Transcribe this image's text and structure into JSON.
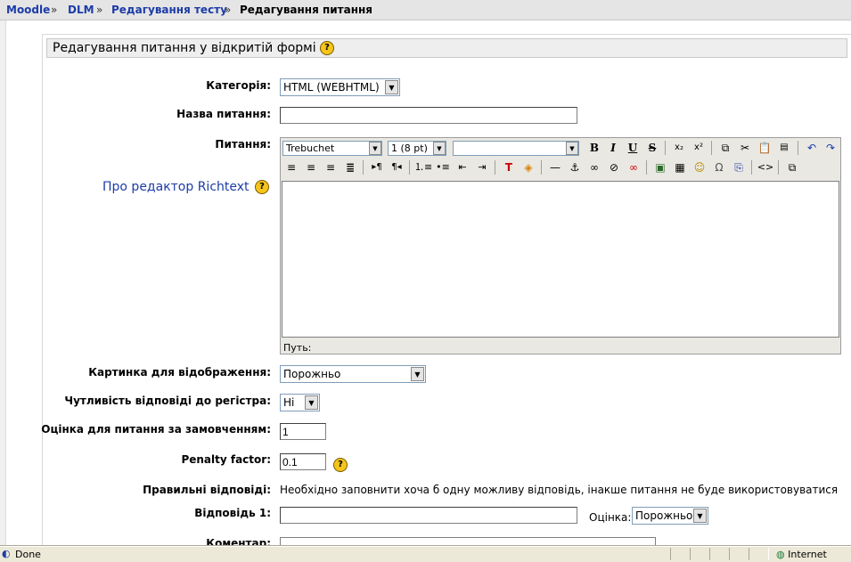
{
  "breadcrumb": {
    "items": [
      "Moodle",
      "DLM",
      "Редагування тесту",
      "Редагування питання"
    ],
    "separator": "»"
  },
  "section": {
    "title": "Редагування питання у відкритій формі"
  },
  "form": {
    "category": {
      "label": "Категорія:",
      "value": "HTML (WEBHTML)"
    },
    "question_name": {
      "label": "Назва питання:",
      "value": ""
    },
    "question_text": {
      "label": "Питання:"
    },
    "richtext_link": "Про редактор Richtext",
    "editor": {
      "font": "Trebuchet",
      "size": "1 (8 pt)",
      "style": "",
      "path_label": "Путь:",
      "toolbar_row1": [
        "bold-icon",
        "italic-icon",
        "underline-icon",
        "strikethrough-icon",
        "subscript-icon",
        "superscript-icon",
        "copy-icon",
        "cut-icon",
        "paste-icon",
        "paste-word-icon",
        "undo-icon",
        "redo-icon"
      ],
      "toolbar_row2": [
        "align-left-icon",
        "align-center-icon",
        "align-right-icon",
        "justify-icon",
        "ltr-icon",
        "rtl-icon",
        "ordered-list-icon",
        "unordered-list-icon",
        "outdent-icon",
        "indent-icon",
        "text-color-icon",
        "bg-color-icon",
        "hr-icon",
        "anchor-icon",
        "link-icon",
        "unlink-icon",
        "nolink-icon",
        "image-icon",
        "table-icon",
        "smiley-icon",
        "special-char-icon",
        "search-replace-icon",
        "html-source-icon",
        "fullscreen-icon"
      ]
    },
    "image": {
      "label": "Картинка для відображення:",
      "value": "Порожньо"
    },
    "case_sensitivity": {
      "label": "Чутливість відповіді до регістра:",
      "value": "Hi"
    },
    "default_grade": {
      "label": "Оцінка для питання за замовченням:",
      "value": "1"
    },
    "penalty": {
      "label": "Penalty factor:",
      "value": "0.1"
    },
    "correct_answers": {
      "label": "Правильні відповіді:",
      "note": "Необхідно заповнити хоча б одну можливу відповідь, інакше питання не буде використовуватися"
    },
    "answer1": {
      "label": "Відповідь 1:",
      "value": "",
      "grade_label": "Оцінка:",
      "grade_value": "Порожньо"
    },
    "comment": {
      "label": "Коментар:"
    }
  },
  "statusbar": {
    "text": "Done",
    "zone": "Internet"
  },
  "colors": {
    "link": "#1c3ca8",
    "help_icon": "#f6c51a",
    "toolbar_bg": "#e9e8e2",
    "statusbar_bg": "#ece9d8"
  }
}
